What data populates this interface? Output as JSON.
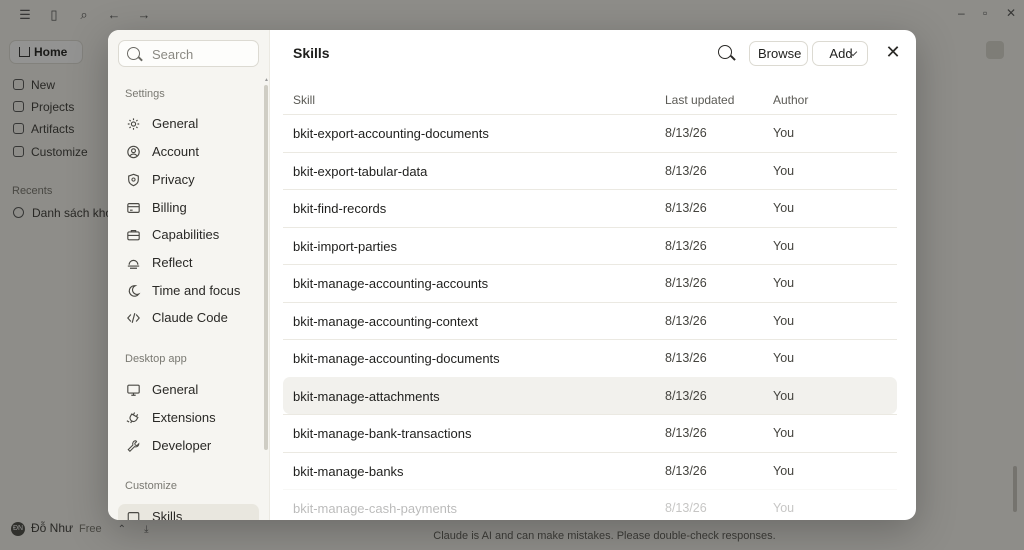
{
  "background": {
    "nav": [
      {
        "label": "New",
        "icon": "plus-icon"
      },
      {
        "label": "Projects",
        "icon": "folder-icon"
      },
      {
        "label": "Artifacts",
        "icon": "artifact-icon"
      },
      {
        "label": "Customize",
        "icon": "customize-icon"
      }
    ],
    "home_label": "Home",
    "recents_label": "Recents",
    "recent_chat": "Danh sách kho",
    "user_name": "Đỗ Như",
    "user_plan": "Free",
    "footer": "Claude is AI and can make mistakes. Please double-check responses."
  },
  "sidebar": {
    "search_placeholder": "Search",
    "sections": [
      {
        "title": "Settings",
        "items": [
          {
            "label": "General",
            "icon": "gear-icon"
          },
          {
            "label": "Account",
            "icon": "user-circle-icon"
          },
          {
            "label": "Privacy",
            "icon": "shield-icon"
          },
          {
            "label": "Billing",
            "icon": "credit-card-icon"
          },
          {
            "label": "Capabilities",
            "icon": "briefcase-icon"
          },
          {
            "label": "Reflect",
            "icon": "reflect-icon"
          },
          {
            "label": "Time and focus",
            "icon": "moon-icon"
          },
          {
            "label": "Claude Code",
            "icon": "code-icon"
          }
        ]
      },
      {
        "title": "Desktop app",
        "items": [
          {
            "label": "General",
            "icon": "monitor-icon"
          },
          {
            "label": "Extensions",
            "icon": "plug-icon"
          },
          {
            "label": "Developer",
            "icon": "wrench-icon"
          }
        ]
      },
      {
        "title": "Customize",
        "items": [
          {
            "label": "Skills",
            "icon": "skills-icon",
            "active": true
          }
        ]
      }
    ]
  },
  "main": {
    "title": "Skills",
    "browse_label": "Browse",
    "add_label": "Add",
    "columns": [
      "Skill",
      "Last updated",
      "Author"
    ],
    "rows": [
      {
        "skill": "bkit-export-accounting-documents",
        "updated": "8/13/26",
        "author": "You"
      },
      {
        "skill": "bkit-export-tabular-data",
        "updated": "8/13/26",
        "author": "You"
      },
      {
        "skill": "bkit-find-records",
        "updated": "8/13/26",
        "author": "You"
      },
      {
        "skill": "bkit-import-parties",
        "updated": "8/13/26",
        "author": "You"
      },
      {
        "skill": "bkit-manage-accounting-accounts",
        "updated": "8/13/26",
        "author": "You"
      },
      {
        "skill": "bkit-manage-accounting-context",
        "updated": "8/13/26",
        "author": "You"
      },
      {
        "skill": "bkit-manage-accounting-documents",
        "updated": "8/13/26",
        "author": "You"
      },
      {
        "skill": "bkit-manage-attachments",
        "updated": "8/13/26",
        "author": "You"
      },
      {
        "skill": "bkit-manage-bank-transactions",
        "updated": "8/13/26",
        "author": "You"
      },
      {
        "skill": "bkit-manage-banks",
        "updated": "8/13/26",
        "author": "You"
      },
      {
        "skill": "bkit-manage-cash-payments",
        "updated": "8/13/26",
        "author": "You"
      }
    ]
  }
}
